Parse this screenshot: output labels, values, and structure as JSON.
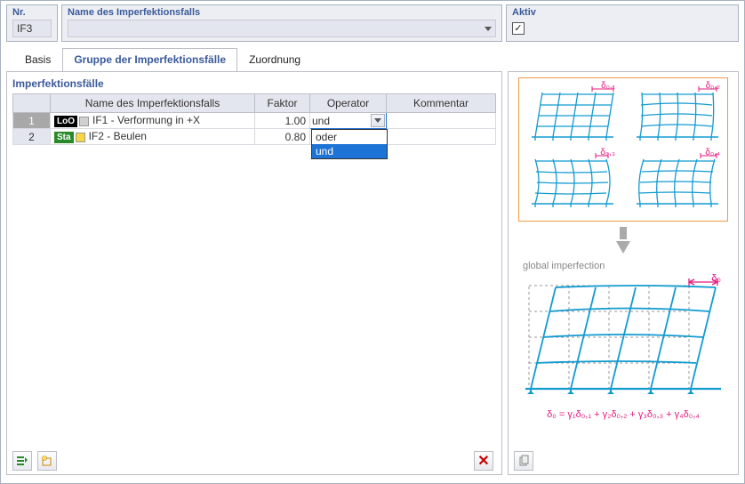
{
  "header": {
    "nr_label": "Nr.",
    "nr_value": "IF3",
    "name_label": "Name des Imperfektionsfalls",
    "name_value": "",
    "aktiv_label": "Aktiv",
    "aktiv_checked": true
  },
  "tabs": {
    "basis": "Basis",
    "gruppe": "Gruppe der Imperfektionsfälle",
    "zuordnung": "Zuordnung",
    "active": "gruppe"
  },
  "panel": {
    "title": "Imperfektionsfälle",
    "columns": {
      "nr": "",
      "name": "Name des Imperfektionsfalls",
      "faktor": "Faktor",
      "operator": "Operator",
      "kommentar": "Kommentar"
    },
    "rows": [
      {
        "num": "1",
        "badge": "LoO",
        "badge_class": "badge-loo",
        "swatch": "sw-grey",
        "name": "IF1 - Verformung in +X",
        "faktor": "1.00",
        "operator": "und"
      },
      {
        "num": "2",
        "badge": "Sta",
        "badge_class": "badge-sta",
        "swatch": "sw-yellow",
        "name": "IF2 - Beulen",
        "faktor": "0.80",
        "operator": ""
      }
    ],
    "operator_options": [
      "oder",
      "und"
    ],
    "operator_selected": "und"
  },
  "diagram": {
    "deltas": [
      "δ₀,₁",
      "δ₀,₂",
      "δ₀,₃",
      "δ₀,₄"
    ],
    "global_label": "global imperfection",
    "delta_big": "δ₀",
    "formula": "δ₀ = γ₁δ₀,₁ + γ₂δ₀,₂ + γ₃δ₀,₃ + γ₄δ₀,₄"
  }
}
